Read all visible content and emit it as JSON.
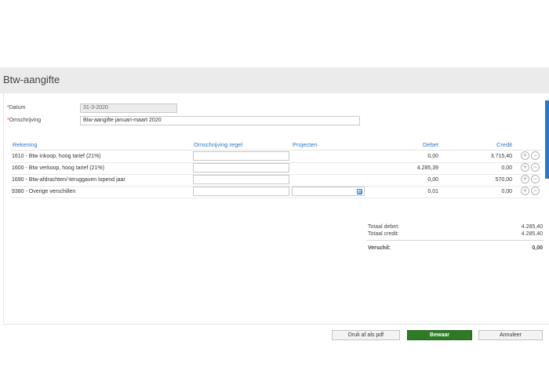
{
  "header": {
    "title": "Btw-aangifte"
  },
  "form": {
    "datum_label": "Datum",
    "datum_value": "31-3-2020",
    "omschrijving_label": "Omschrijving",
    "omschrijving_value": "Btw-aangifte januari-maart 2020",
    "required_mark": "*"
  },
  "table": {
    "headers": {
      "rekening": "Rekening",
      "omschrijving_regel": "Omschrijving regel",
      "projecten": "Projecten",
      "debet": "Debet",
      "credit": "Credit"
    },
    "rows": [
      {
        "rekening": "1610 - Btw inkoop, hoog tarief (21%)",
        "debet": "0,00",
        "credit": "3.715,40"
      },
      {
        "rekening": "1600 - Btw verkoop, hoog tarief (21%)",
        "debet": "4.285,39",
        "credit": "0,00"
      },
      {
        "rekening": "1690 - Btw-afdrachten/-teruggaven lopend jaar",
        "debet": "0,00",
        "credit": "570,00"
      },
      {
        "rekening": "9380 - Overige verschillen",
        "debet": "0,01",
        "credit": "0,00"
      }
    ],
    "add_symbol": "+",
    "remove_symbol": "−"
  },
  "totals": {
    "totaal_debet_label": "Totaal debet:",
    "totaal_debet_value": "4.285,40",
    "totaal_credit_label": "Totaal credit:",
    "totaal_credit_value": "4.285,40",
    "verschil_label": "Verschil:",
    "verschil_value": "0,00"
  },
  "footer": {
    "pdf_label": "Druk af als pdf",
    "save_label": "Bewaar",
    "cancel_label": "Annuleer"
  },
  "colors": {
    "accent": "#2a79c8",
    "primary_button": "#2e7a25",
    "required": "#d33333"
  },
  "icons": {
    "project_lookup": "search-lookup-icon",
    "add_row": "plus-circle-icon",
    "remove_row": "minus-circle-icon"
  }
}
